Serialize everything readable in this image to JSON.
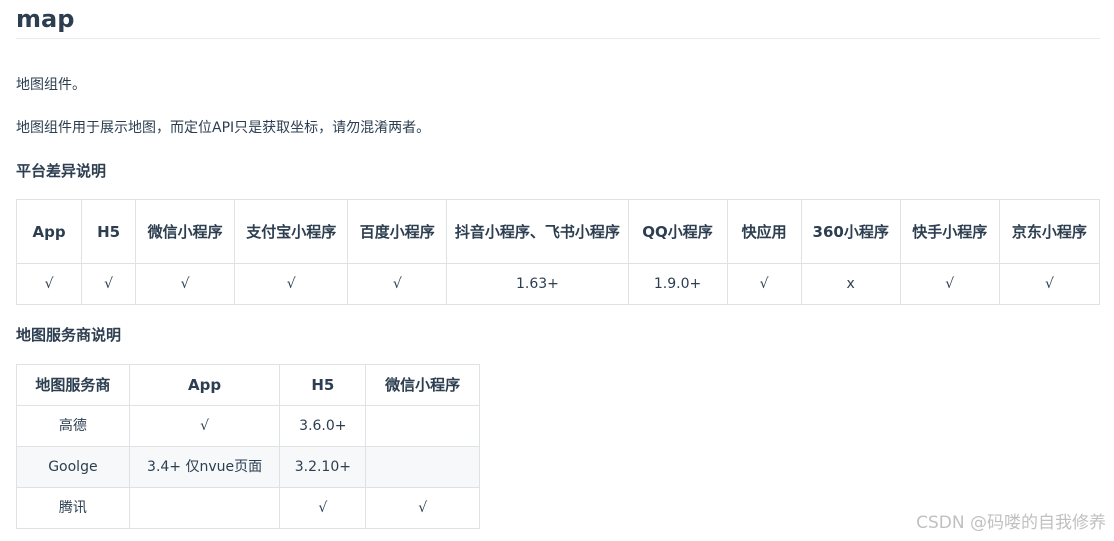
{
  "title": "map",
  "intro": "地图组件。",
  "description": "地图组件用于展示地图，而定位API只是获取坐标，请勿混淆两者。",
  "platform_section": {
    "heading": "平台差异说明",
    "headers": [
      "App",
      "H5",
      "微信小程序",
      "支付宝小程序",
      "百度小程序",
      "抖音小程序、飞书小程序",
      "QQ小程序",
      "快应用",
      "360小程序",
      "快手小程序",
      "京东小程序"
    ],
    "row": [
      "√",
      "√",
      "√",
      "√",
      "√",
      "1.63+",
      "1.9.0+",
      "√",
      "x",
      "√",
      "√"
    ]
  },
  "provider_section": {
    "heading": "地图服务商说明",
    "headers": [
      "地图服务商",
      "App",
      "H5",
      "微信小程序"
    ],
    "rows": [
      [
        "高德",
        "√",
        "3.6.0+",
        ""
      ],
      [
        "Goolge",
        "3.4+ 仅nvue页面",
        "3.2.10+",
        ""
      ],
      [
        "腾讯",
        "",
        "√",
        "√"
      ]
    ]
  },
  "watermark": "CSDN @码喽的自我修养"
}
